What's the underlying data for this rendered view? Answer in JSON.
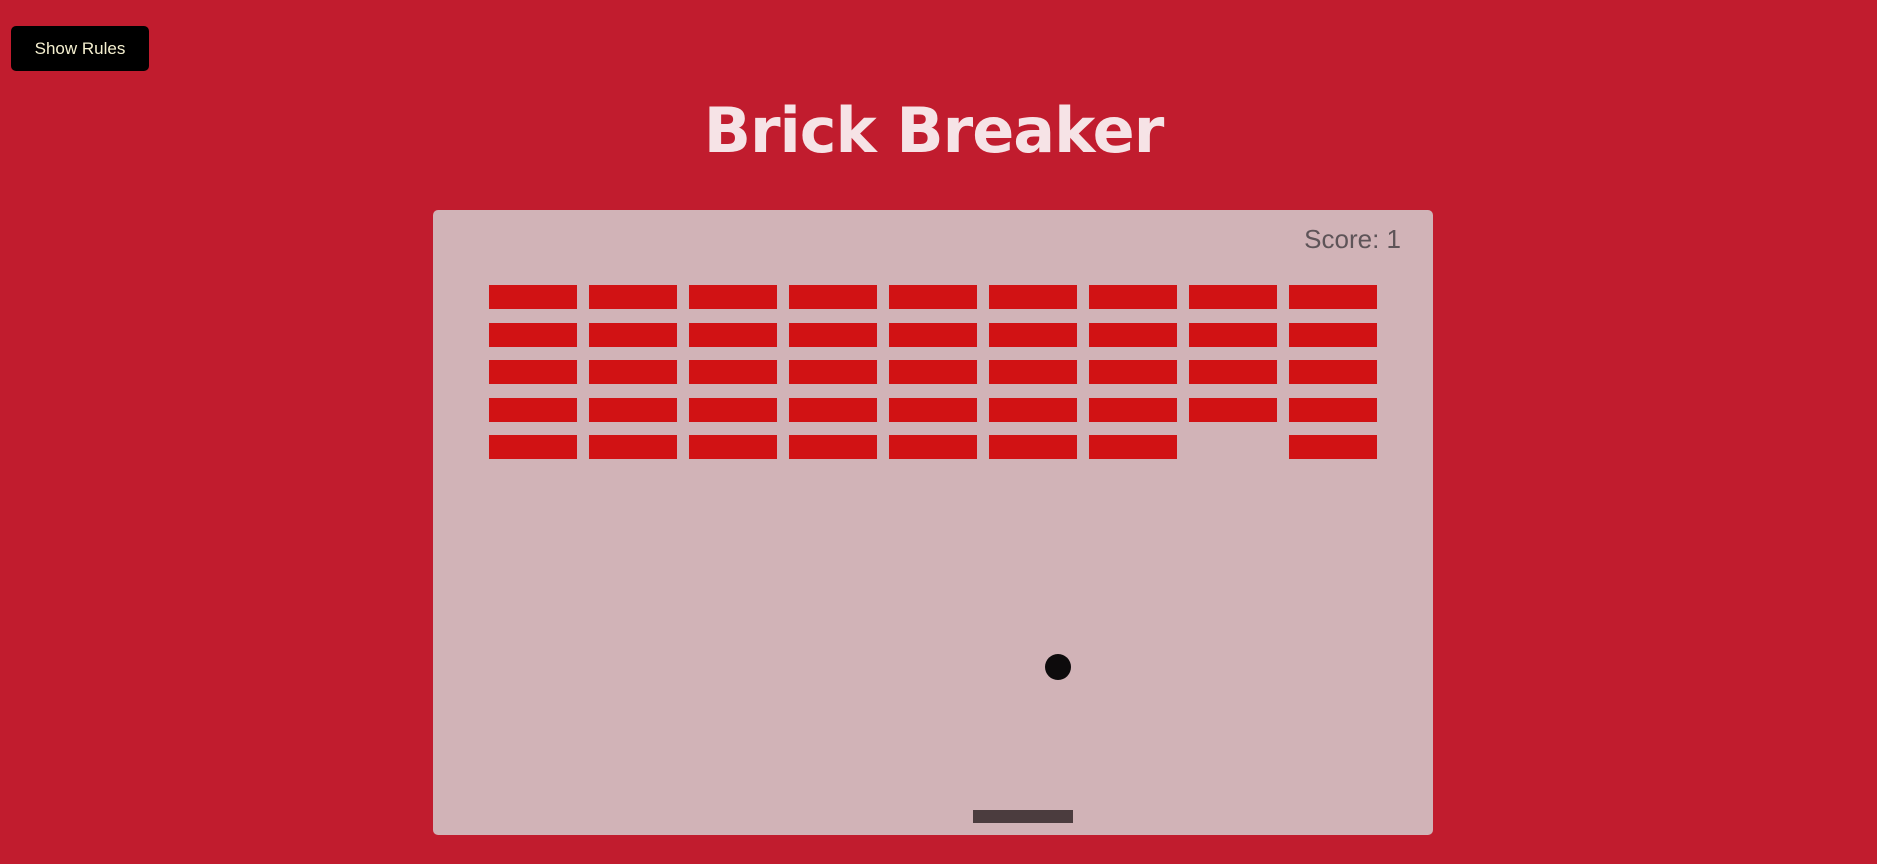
{
  "header": {
    "rules_button_label": "Show Rules",
    "title": "Brick Breaker"
  },
  "game": {
    "score_label": "Score: 1",
    "score": 1,
    "brick_color": "#d11214",
    "board_color": "#d1b3b7",
    "paddle_color": "#4b3c3e",
    "ball_color": "#0d0b0c",
    "background_color": "#c11c2e",
    "brick_grid": {
      "columns": 9,
      "rows": 5,
      "bricks": [
        [
          true,
          true,
          true,
          true,
          true
        ],
        [
          true,
          true,
          true,
          true,
          true
        ],
        [
          true,
          true,
          true,
          true,
          true
        ],
        [
          true,
          true,
          true,
          true,
          true
        ],
        [
          true,
          true,
          true,
          true,
          true
        ],
        [
          true,
          true,
          true,
          true,
          true
        ],
        [
          true,
          true,
          true,
          true,
          true
        ],
        [
          true,
          true,
          true,
          true,
          false
        ],
        [
          true,
          true,
          true,
          true,
          true
        ]
      ]
    }
  }
}
